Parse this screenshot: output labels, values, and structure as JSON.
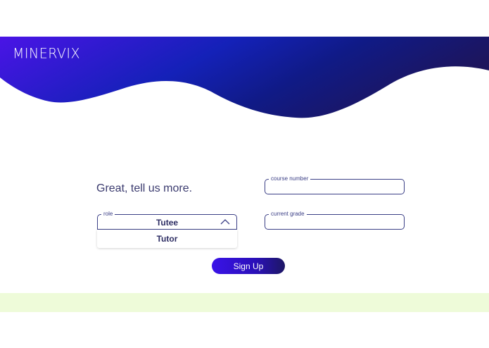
{
  "app": {
    "logo": "MINERVIX"
  },
  "form": {
    "headline": "Great, tell us more.",
    "course_number_label": "course number",
    "course_number_value": "",
    "role_label": "role",
    "role_value": "Tutee",
    "role_options": [
      "Tutor"
    ],
    "current_grade_label": "current grade",
    "current_grade_value": "",
    "submit_label": "Sign Up"
  },
  "colors": {
    "accent": "#3a12e8",
    "header_dark": "#1d1764",
    "footer_band": "#eefbd9"
  }
}
